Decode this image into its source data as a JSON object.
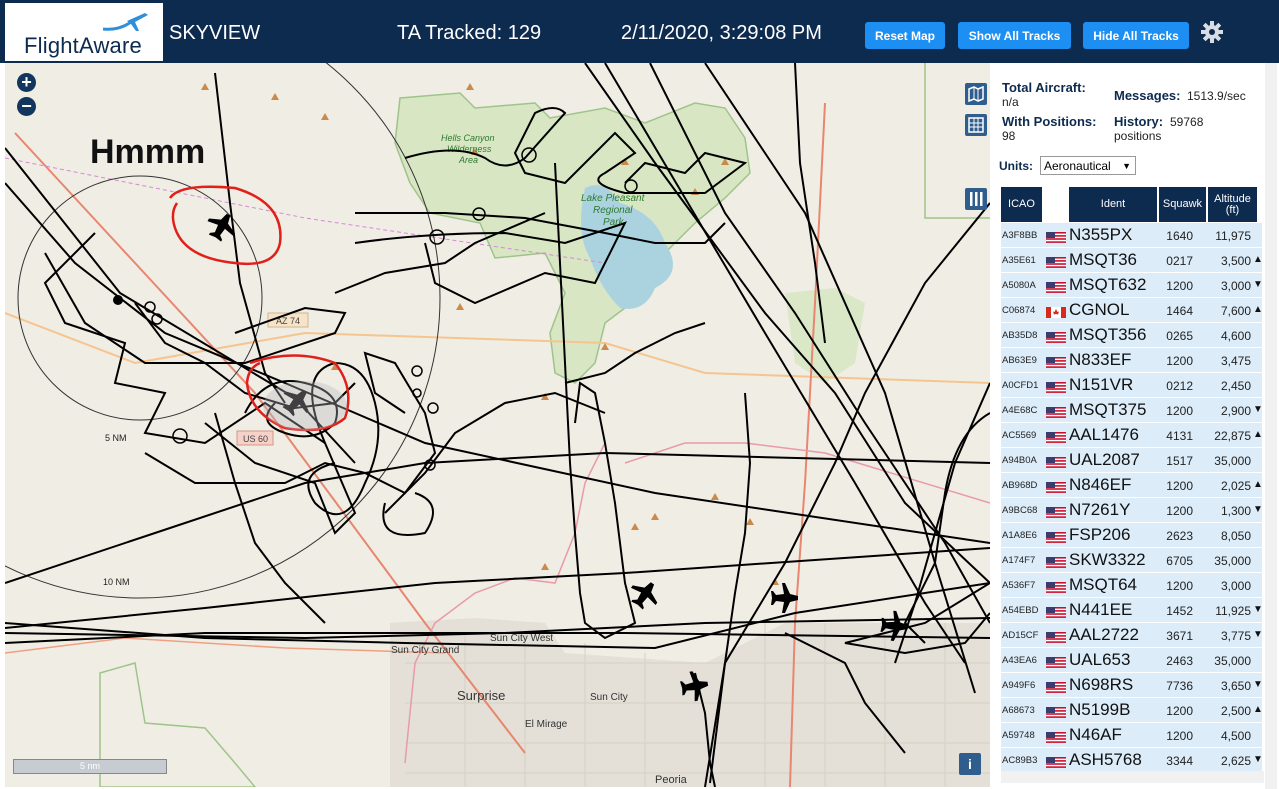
{
  "header": {
    "logo": "FlightAware",
    "app_title": "SKYVIEW",
    "ta_tracked": "TA Tracked: 129",
    "datetime": "2/11/2020, 3:29:08 PM",
    "buttons": {
      "reset": "Reset Map",
      "show_all": "Show All Tracks",
      "hide_all": "Hide All Tracks"
    }
  },
  "map": {
    "zoom_in": "+",
    "zoom_out": "−",
    "annotation": "Hmmm",
    "scale": "5 nm",
    "info": "i",
    "range_rings": [
      "5 NM",
      "10 NM"
    ],
    "places": {
      "hells_canyon": [
        "Hells Canyon",
        "Wilderness",
        "Area"
      ],
      "lake_pleasant": [
        "Lake Pleasant",
        "Regional",
        "Park"
      ],
      "sun_city_west": "Sun City West",
      "sun_city_grand": "Sun City Grand",
      "surprise": "Surprise",
      "sun_city": "Sun City",
      "el_mirage": "El Mirage",
      "peoria": "Peoria"
    },
    "road_labels": [
      "AZ 74",
      "US 60"
    ]
  },
  "stats": {
    "total_aircraft_label": "Total Aircraft:",
    "total_aircraft": "n/a",
    "with_positions_label": "With Positions:",
    "with_positions": "98",
    "messages_label": "Messages:",
    "messages": "1513.9/sec",
    "history_label": "History:",
    "history_value": "59768",
    "history_unit": "positions"
  },
  "units": {
    "label": "Units:",
    "selected": "Aeronautical"
  },
  "table": {
    "columns": [
      "ICAO",
      "Ident",
      "Squawk",
      "Altitude (ft)"
    ],
    "rows": [
      {
        "icao": "A3F8BB",
        "country": "US",
        "ident": "N355PX",
        "squawk": "1640",
        "altitude": "11,975",
        "trend": ""
      },
      {
        "icao": "A35E61",
        "country": "US",
        "ident": "MSQT36",
        "squawk": "0217",
        "altitude": "3,500",
        "trend": "▲"
      },
      {
        "icao": "A5080A",
        "country": "US",
        "ident": "MSQT632",
        "squawk": "1200",
        "altitude": "3,000",
        "trend": "▼"
      },
      {
        "icao": "C06874",
        "country": "CA",
        "ident": "CGNOL",
        "squawk": "1464",
        "altitude": "7,600",
        "trend": "▲"
      },
      {
        "icao": "AB35D8",
        "country": "US",
        "ident": "MSQT356",
        "squawk": "0265",
        "altitude": "4,600",
        "trend": ""
      },
      {
        "icao": "AB63E9",
        "country": "US",
        "ident": "N833EF",
        "squawk": "1200",
        "altitude": "3,475",
        "trend": ""
      },
      {
        "icao": "A0CFD1",
        "country": "US",
        "ident": "N151VR",
        "squawk": "0212",
        "altitude": "2,450",
        "trend": ""
      },
      {
        "icao": "A4E68C",
        "country": "US",
        "ident": "MSQT375",
        "squawk": "1200",
        "altitude": "2,900",
        "trend": "▼"
      },
      {
        "icao": "AC5569",
        "country": "US",
        "ident": "AAL1476",
        "squawk": "4131",
        "altitude": "22,875",
        "trend": "▲"
      },
      {
        "icao": "A94B0A",
        "country": "US",
        "ident": "UAL2087",
        "squawk": "1517",
        "altitude": "35,000",
        "trend": ""
      },
      {
        "icao": "AB968D",
        "country": "US",
        "ident": "N846EF",
        "squawk": "1200",
        "altitude": "2,025",
        "trend": "▲"
      },
      {
        "icao": "A9BC68",
        "country": "US",
        "ident": "N7261Y",
        "squawk": "1200",
        "altitude": "1,300",
        "trend": "▼"
      },
      {
        "icao": "A1A8E6",
        "country": "US",
        "ident": "FSP206",
        "squawk": "2623",
        "altitude": "8,050",
        "trend": ""
      },
      {
        "icao": "A174F7",
        "country": "US",
        "ident": "SKW3322",
        "squawk": "6705",
        "altitude": "35,000",
        "trend": ""
      },
      {
        "icao": "A536F7",
        "country": "US",
        "ident": "MSQT64",
        "squawk": "1200",
        "altitude": "3,000",
        "trend": ""
      },
      {
        "icao": "A54EBD",
        "country": "US",
        "ident": "N441EE",
        "squawk": "1452",
        "altitude": "11,925",
        "trend": "▼"
      },
      {
        "icao": "AD15CF",
        "country": "US",
        "ident": "AAL2722",
        "squawk": "3671",
        "altitude": "3,775",
        "trend": "▼"
      },
      {
        "icao": "A43EA6",
        "country": "US",
        "ident": "UAL653",
        "squawk": "2463",
        "altitude": "35,000",
        "trend": ""
      },
      {
        "icao": "A949F6",
        "country": "US",
        "ident": "N698RS",
        "squawk": "7736",
        "altitude": "3,650",
        "trend": "▼"
      },
      {
        "icao": "A68673",
        "country": "US",
        "ident": "N5199B",
        "squawk": "1200",
        "altitude": "2,500",
        "trend": "▲"
      },
      {
        "icao": "A59748",
        "country": "US",
        "ident": "N46AF",
        "squawk": "1200",
        "altitude": "4,500",
        "trend": ""
      },
      {
        "icao": "AC89B3",
        "country": "US",
        "ident": "ASH5768",
        "squawk": "3344",
        "altitude": "2,625",
        "trend": "▼"
      }
    ]
  },
  "colors": {
    "header_bg": "#0d2a4f",
    "button": "#1d8ff3",
    "row_bg": "#dcecf9",
    "annotation_red": "#e0201b"
  }
}
